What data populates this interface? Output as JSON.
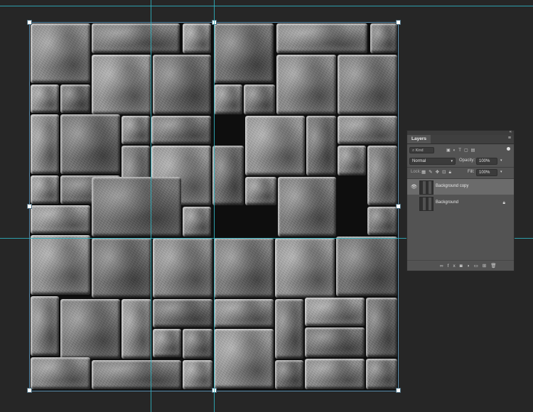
{
  "canvas": {
    "description_icon": "stone-tile-texture"
  },
  "guides": {
    "color": "#2fb6c4"
  },
  "layers_panel": {
    "tab_label": "Layers",
    "collapse_glyph": "«",
    "menu_glyph": "≡",
    "filter": {
      "kind_label": "Kind",
      "icons": [
        "image-filter-icon",
        "adjustment-filter-icon",
        "type-filter-icon",
        "shape-filter-icon",
        "smart-object-filter-icon"
      ]
    },
    "blend_mode": "Normal",
    "opacity_label": "Opacity:",
    "opacity_value": "100%",
    "lock_label": "Lock:",
    "fill_label": "Fill:",
    "fill_value": "100%",
    "layers": [
      {
        "name": "Background copy",
        "visible": true,
        "selected": true,
        "locked": false
      },
      {
        "name": "Background",
        "visible": false,
        "selected": false,
        "locked": true
      }
    ],
    "footer_icons": [
      "link-layers-icon",
      "fx-icon",
      "add-mask-icon",
      "adjustment-layer-icon",
      "new-group-icon",
      "new-layer-icon",
      "delete-layer-icon"
    ]
  },
  "colors": {
    "workspace_bg": "#262626",
    "panel_bg": "#535353",
    "selected_row": "#6b6b6b",
    "guide": "#2fb6c4"
  }
}
